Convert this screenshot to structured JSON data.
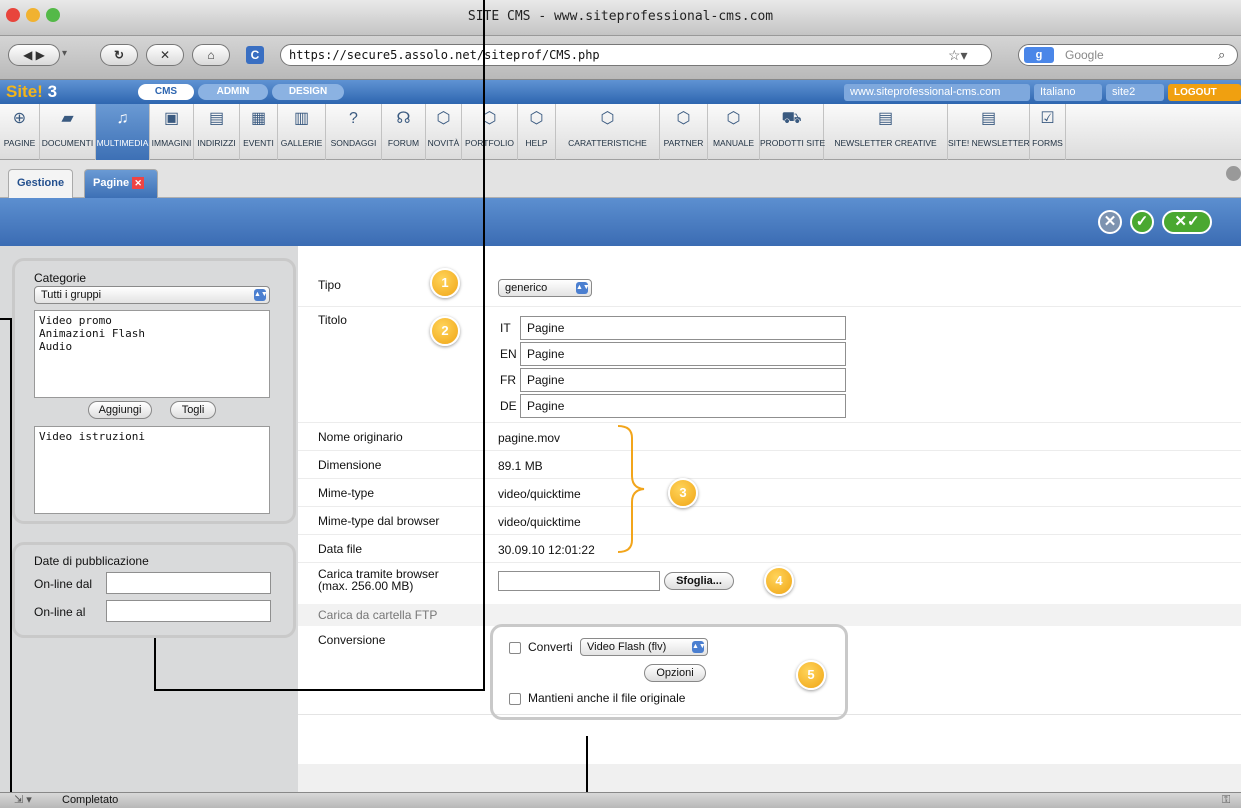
{
  "window": {
    "title": "SITE CMS - www.siteprofessional-cms.com"
  },
  "browser": {
    "url": "https://secure5.assolo.net/siteprof/CMS.php",
    "search_placeholder": "Google"
  },
  "app": {
    "logo": "Site! 3",
    "tabs": [
      "CMS",
      "ADMIN",
      "DESIGN"
    ],
    "site_url": "www.siteprofessional-cms.com",
    "language": "Italiano",
    "user": "site2",
    "logout": "LOGOUT"
  },
  "toolbar": [
    {
      "label": "PAGINE",
      "icon": "globe-icon"
    },
    {
      "label": "DOCUMENTI",
      "icon": "folder-icon"
    },
    {
      "label": "MULTIMEDIA",
      "icon": "media-icon"
    },
    {
      "label": "IMMAGINI",
      "icon": "image-icon"
    },
    {
      "label": "INDIRIZZI",
      "icon": "address-icon"
    },
    {
      "label": "EVENTI",
      "icon": "calendar-icon"
    },
    {
      "label": "GALLERIE",
      "icon": "gallery-icon"
    },
    {
      "label": "SONDAGGI",
      "icon": "question-icon"
    },
    {
      "label": "FORUM",
      "icon": "chat-icon"
    },
    {
      "label": "NOVITÀ",
      "icon": "box-icon"
    },
    {
      "label": "PORTFOLIO",
      "icon": "box-icon"
    },
    {
      "label": "HELP",
      "icon": "box-icon"
    },
    {
      "label": "CARATTERISTICHE",
      "icon": "box-icon"
    },
    {
      "label": "PARTNER",
      "icon": "box-icon"
    },
    {
      "label": "MANUALE",
      "icon": "box-icon"
    },
    {
      "label": "PRODOTTI SITE",
      "icon": "cart-icon"
    },
    {
      "label": "NEWSLETTER CREATIVE",
      "icon": "news-icon"
    },
    {
      "label": "SITE! NEWSLETTER",
      "icon": "news-icon"
    },
    {
      "label": "FORMS",
      "icon": "checkbox-icon"
    }
  ],
  "subtabs": {
    "gestione": "Gestione",
    "pagine": "Pagine"
  },
  "left": {
    "categorie_title": "Categorie",
    "group_select": "Tutti i gruppi",
    "categories": [
      "Video promo",
      "Animazioni Flash",
      "Audio"
    ],
    "add": "Aggiungi",
    "remove": "Togli",
    "selected": [
      "Video istruzioni"
    ],
    "pub_title": "Date di pubblicazione",
    "online_from": "On-line dal",
    "online_to": "On-line al"
  },
  "form": {
    "tipo": "Tipo",
    "tipo_value": "generico",
    "titolo": "Titolo",
    "titles": [
      {
        "lang": "IT",
        "value": "Pagine"
      },
      {
        "lang": "EN",
        "value": "Pagine"
      },
      {
        "lang": "FR",
        "value": "Pagine"
      },
      {
        "lang": "DE",
        "value": "Pagine"
      }
    ],
    "info": [
      {
        "label": "Nome originario",
        "value": "pagine.mov"
      },
      {
        "label": "Dimensione",
        "value": "89.1 MB"
      },
      {
        "label": "Mime-type",
        "value": "video/quicktime"
      },
      {
        "label": "Mime-type dal browser",
        "value": "video/quicktime"
      },
      {
        "label": "Data file",
        "value": "30.09.10 12:01:22"
      }
    ],
    "upload_label_1": "Carica tramite browser",
    "upload_label_2": "(max. 256.00 MB)",
    "browse": "Sfoglia...",
    "ftp": "Carica da cartella FTP",
    "conversione": "Conversione",
    "converti": "Converti",
    "format": "Video Flash (flv)",
    "opzioni": "Opzioni",
    "keep": "Mantieni anche il file originale"
  },
  "callouts": [
    "1",
    "2",
    "3",
    "4",
    "5"
  ],
  "status": "Completato"
}
